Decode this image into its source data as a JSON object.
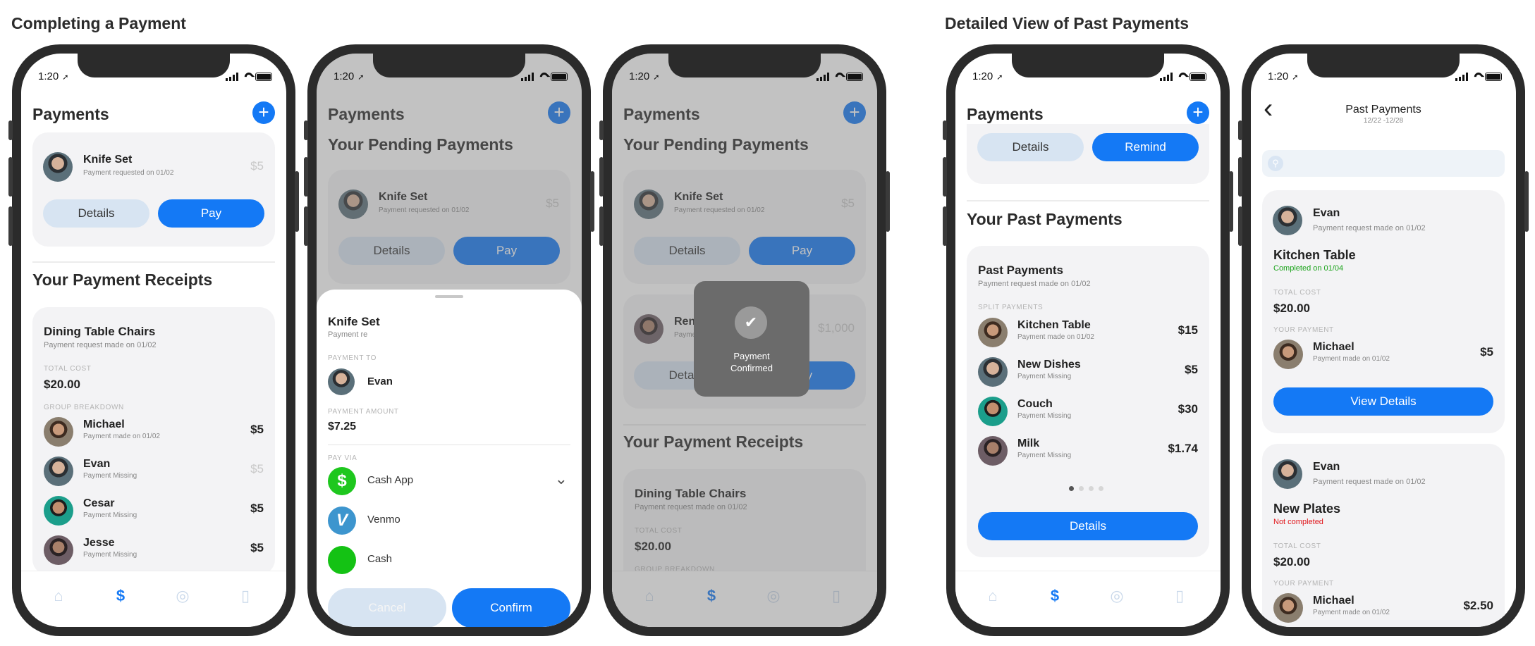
{
  "sections": {
    "left_title": "Completing a Payment",
    "right_title": "Detailed View of Past Payments"
  },
  "status": {
    "time": "1:20"
  },
  "colors": {
    "primary": "#1479f5",
    "light_button": "#d7e4f2",
    "card": "#f3f3f5",
    "completed": "#1aa31a",
    "not_completed": "#e0151a"
  },
  "icons": {
    "plus": "+",
    "back": "‹",
    "check": "✔",
    "chevron_down": "⌄",
    "search": "⚲",
    "location": "➚"
  },
  "tabs": {
    "home": "⌂",
    "payments": "$",
    "circle": "◎",
    "receipt": "▯"
  },
  "screen1": {
    "title": "Payments",
    "pending": {
      "name": "Knife Set",
      "sub": "Payment requested on 01/02",
      "amount": "$5",
      "details": "Details",
      "pay": "Pay"
    },
    "receipts_title": "Your Payment Receipts",
    "receipt": {
      "title": "Dining Table Chairs",
      "sub": "Payment request made on 01/02",
      "total_label": "TOTAL COST",
      "total": "$20.00",
      "group_label": "GROUP BREAKDOWN",
      "members": [
        {
          "name": "Michael",
          "sub": "Payment made on 01/02",
          "amount": "$5"
        },
        {
          "name": "Evan",
          "sub": "Payment Missing",
          "amount": "$5"
        },
        {
          "name": "Cesar",
          "sub": "Payment Missing",
          "amount": "$5"
        },
        {
          "name": "Jesse",
          "sub": "Payment Missing",
          "amount": "$5"
        }
      ]
    }
  },
  "screen2": {
    "title": "Payments",
    "pending_title": "Your Pending Payments",
    "pending": {
      "name": "Knife Set",
      "sub": "Payment requested on 01/02",
      "amount": "$5",
      "details": "Details",
      "pay": "Pay"
    },
    "sheet": {
      "title": "Knife Set",
      "sub": "Payment re",
      "to_label": "PAYMENT TO",
      "to_name": "Evan",
      "amount_label": "PAYMENT AMOUNT",
      "amount": "$7.25",
      "via_label": "PAY VIA",
      "options": [
        {
          "name": "Cash App",
          "glyph": "$"
        },
        {
          "name": "Venmo",
          "glyph": "V"
        },
        {
          "name": "Cash",
          "glyph": ""
        }
      ],
      "cancel": "Cancel",
      "confirm": "Confirm"
    }
  },
  "screen3": {
    "title": "Payments",
    "pending_title": "Your Pending Payments",
    "pending1": {
      "name": "Knife Set",
      "sub": "Payment requested on 01/02",
      "amount": "$5",
      "details": "Details",
      "pay": "Pay"
    },
    "pending2": {
      "name": "Rent",
      "sub": "Payment re",
      "amount": "$1,000",
      "details": "Details",
      "pay": "Pay"
    },
    "toast": {
      "line1": "Payment",
      "line2": "Confirmed"
    },
    "receipts_title": "Your Payment Receipts",
    "receipt": {
      "title": "Dining Table Chairs",
      "sub": "Payment request made on 01/02",
      "total_label": "TOTAL COST",
      "total": "$20.00",
      "group_label": "GROUP BREAKDOWN"
    }
  },
  "screen4": {
    "title": "Payments",
    "details": "Details",
    "remind": "Remind",
    "past_title": "Your Past Payments",
    "card": {
      "title": "Past Payments",
      "sub": "Payment request made on 01/02",
      "split_label": "SPLIT PAYMENTS",
      "items": [
        {
          "name": "Kitchen Table",
          "sub": "Payment made on 01/02",
          "amount": "$15"
        },
        {
          "name": "New Dishes",
          "sub": "Payment Missing",
          "amount": "$5"
        },
        {
          "name": "Couch",
          "sub": "Payment Missing",
          "amount": "$30"
        },
        {
          "name": "Milk",
          "sub": "Payment Missing",
          "amount": "$1.74"
        }
      ],
      "details": "Details"
    }
  },
  "screen5": {
    "title": "Past Payments",
    "range": "12/22 -12/28",
    "cards": [
      {
        "name": "Evan",
        "sub": "Payment request made on 01/02",
        "item": "Kitchen Table",
        "status": "Completed on 01/04",
        "total_label": "TOTAL COST",
        "total": "$20.00",
        "your_label": "YOUR PAYMENT",
        "payer": "Michael",
        "payer_sub": "Payment made on 01/02",
        "payer_amount": "$5",
        "button": "View Details"
      },
      {
        "name": "Evan",
        "sub": "Payment request made on 01/02",
        "item": "New Plates",
        "status": "Not completed",
        "total_label": "TOTAL COST",
        "total": "$20.00",
        "your_label": "YOUR PAYMENT",
        "payer": "Michael",
        "payer_sub": "Payment made on 01/02",
        "payer_amount": "$2.50"
      }
    ]
  }
}
